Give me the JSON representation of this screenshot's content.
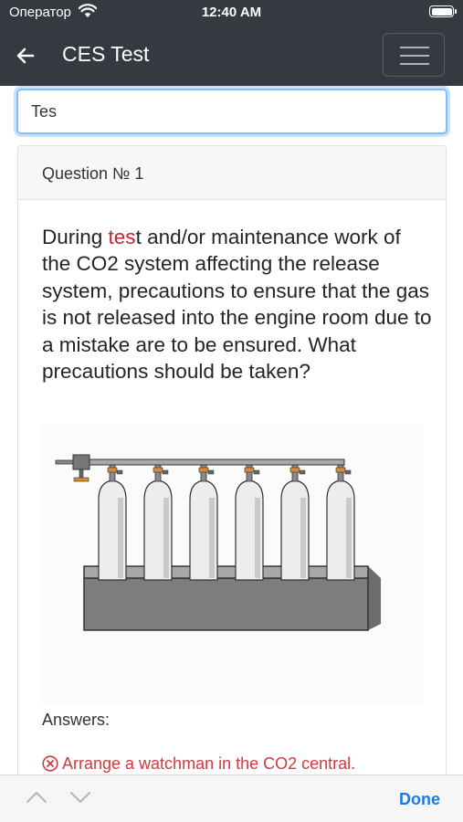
{
  "status_bar": {
    "carrier": "Оператор",
    "time": "12:40 AM",
    "wifi_icon": "wifi-icon",
    "battery_icon": "battery-icon"
  },
  "navbar": {
    "title": "CES Test",
    "back_icon": "arrow-left-icon",
    "menu_icon": "hamburger-menu-icon",
    "background": "#343a40"
  },
  "search": {
    "value": "Tes"
  },
  "question_card": {
    "header": "Question № 1",
    "text_highlight": "tes",
    "text_before": "During ",
    "text_after": "t and/or maintenance work of the CO2 system affecting the release system, precautions to ensure that the gas is not released into the engine room due to a mistake are to be ensured. What precautions should be taken?",
    "highlight_color": "#c0272d",
    "image": "co2-cylinder-bank-illustration",
    "answers_label": "Answers:",
    "answers": [
      {
        "text": "Arrange a watchman in the CO2 central.",
        "status": "incorrect",
        "icon": "x-circle-icon",
        "color": "#cf3a3e"
      }
    ]
  },
  "keyboard_toolbar": {
    "prev_icon": "chevron-up-icon",
    "next_icon": "chevron-down-icon",
    "done_label": "Done",
    "accent": "#1d7ce3"
  }
}
